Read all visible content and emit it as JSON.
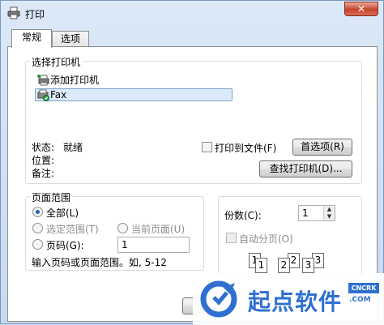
{
  "window": {
    "title": "打印",
    "close_glyph": "✕"
  },
  "tabs": [
    {
      "label": "常规",
      "active": true
    },
    {
      "label": "选项",
      "active": false
    }
  ],
  "select_printer": {
    "legend": "选择打印机",
    "items": [
      {
        "label": "添加打印机",
        "icon": "add-printer-icon"
      },
      {
        "label": "Fax",
        "icon": "fax-printer-icon",
        "selected": true
      }
    ],
    "status_label": "状态:",
    "status_value": "就绪",
    "location_label": "位置:",
    "comment_label": "备注:",
    "print_to_file_label": "打印到文件(F)",
    "print_to_file_checked": false,
    "preferences_button": "首选项(R)",
    "find_printer_button": "查找打印机(D)..."
  },
  "page_range": {
    "legend": "页面范围",
    "all_label": "全部(L)",
    "selection_label": "选定范围(T)",
    "current_page_label": "当前页面(U)",
    "pages_label": "页码(G):",
    "pages_value": "1",
    "hint": "输入页码或页面范围。如, 5-12",
    "selected": "all"
  },
  "copies": {
    "label": "份数(C):",
    "value": "1",
    "collate_label": "自动分页(O)",
    "collate_checked": false,
    "collate_numbers": [
      "1",
      "1",
      "2",
      "2",
      "3",
      "3"
    ]
  },
  "watermark": {
    "brand": "起点软件",
    "badge": "CNCRK",
    "domain": ".COM"
  },
  "colors": {
    "accent": "#2f6fd0",
    "selection": "#dcebfc",
    "close": "#c7452f"
  }
}
